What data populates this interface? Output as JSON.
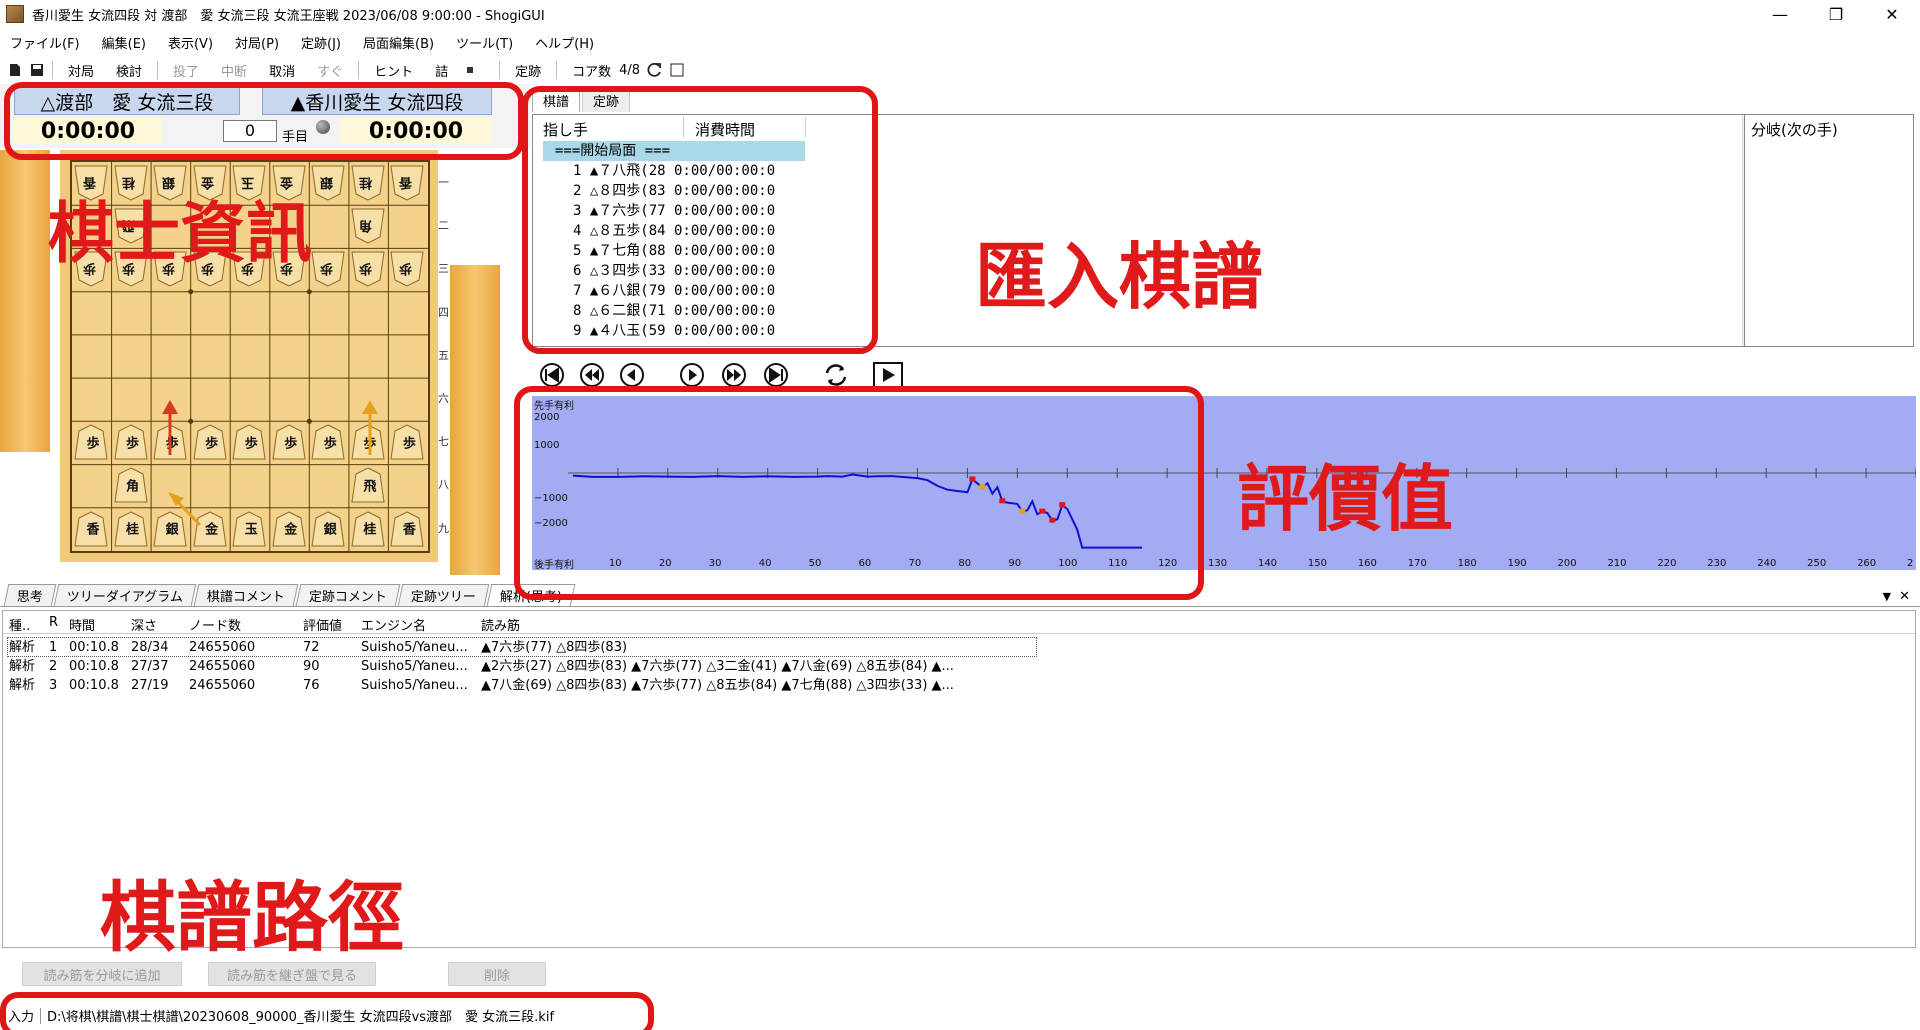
{
  "window": {
    "title": "香川愛生 女流四段 対 渡部　愛 女流三段 女流王座戦 2023/06/08 9:00:00 - ShogiGUI"
  },
  "menu": [
    "ファイル(F)",
    "編集(E)",
    "表示(V)",
    "対局(P)",
    "定跡(J)",
    "局面編集(B)",
    "ツール(T)",
    "ヘルプ(H)"
  ],
  "toolbar": {
    "taikyoku": "対局",
    "kento": "検討",
    "toryo": "投了",
    "chudan": "中断",
    "torikeshi": "取消",
    "sugu": "すぐ",
    "hint": "ヒント",
    "tsume": "詰",
    "joseki": "定跡",
    "cores_label": "コア数",
    "cores_value": "4/8"
  },
  "players": {
    "gote_name": "△渡部　愛 女流三段",
    "sente_name": "▲香川愛生 女流四段",
    "gote_time": "0:00:00",
    "sente_time": "0:00:00",
    "move_number": "0",
    "move_label": "手目"
  },
  "board": {
    "rank_labels": [
      "一",
      "二",
      "三",
      "四",
      "五",
      "六",
      "七",
      "八",
      "九"
    ]
  },
  "kifu": {
    "tabs": [
      "棋譜",
      "定跡"
    ],
    "col_move": "指し手",
    "col_time": "消費時間",
    "rows": [
      "===開始局面 ===",
      "1 ▲７八飛(28  0:00/00:00:0",
      "2 △８四歩(83  0:00/00:00:0",
      "3 ▲７六歩(77  0:00/00:00:0",
      "4 △８五歩(84  0:00/00:00:0",
      "5 ▲７七角(88  0:00/00:00:0",
      "6 △３四歩(33  0:00/00:00:0",
      "7 ▲６八銀(79  0:00/00:00:0",
      "8 △６二銀(71  0:00/00:00:0",
      "9 ▲４八玉(59  0:00/00:00:0"
    ],
    "branch_label": "分岐(次の手)"
  },
  "graph": {
    "top_label": "先手有利",
    "bottom_label": "後手有利",
    "y_ticks": [
      "2000",
      "1000",
      "−1000",
      "−2000"
    ],
    "x_ticks": [
      "10",
      "20",
      "30",
      "40",
      "50",
      "60",
      "70",
      "80",
      "90",
      "100",
      "110",
      "120",
      "130",
      "140",
      "150",
      "160",
      "170",
      "180",
      "190",
      "200",
      "210",
      "220",
      "230",
      "240",
      "250",
      "260",
      "2"
    ]
  },
  "chart_data": {
    "type": "line",
    "x": [
      1,
      5,
      10,
      15,
      20,
      25,
      30,
      35,
      40,
      45,
      50,
      52,
      55,
      57,
      60,
      62,
      65,
      68,
      70,
      72,
      74,
      76,
      78,
      80,
      81,
      83,
      84,
      85,
      86,
      87,
      88,
      90,
      91,
      92,
      93,
      94,
      95,
      96,
      97,
      98,
      99,
      100,
      101,
      102,
      103,
      104,
      105,
      106,
      107,
      108,
      109,
      110,
      115
    ],
    "y": [
      -100,
      -150,
      -150,
      -130,
      -140,
      -150,
      -120,
      -150,
      -130,
      -150,
      -140,
      -120,
      -140,
      -60,
      -140,
      -130,
      -120,
      -170,
      -200,
      -280,
      -500,
      -650,
      -700,
      -750,
      -250,
      -550,
      -400,
      -800,
      -550,
      -1100,
      -1150,
      -1200,
      -1500,
      -1450,
      -1100,
      -1600,
      -1500,
      -1550,
      -1850,
      -1800,
      -1250,
      -1400,
      -1800,
      -2200,
      -2900,
      -2900,
      -2900,
      -2900,
      -2900,
      -2900,
      -2900,
      -2900,
      -2900
    ],
    "ylim": [
      -2900,
      2400
    ],
    "xlim": [
      0,
      270
    ],
    "series_color": "#1010d0"
  },
  "bottom_tabs": [
    "思考",
    "ツリーダイアグラム",
    "棋譜コメント",
    "定跡コメント",
    "定跡ツリー",
    "解析(思考)"
  ],
  "engine": {
    "headers": [
      "種..",
      "R",
      "時間",
      "深さ",
      "ノード数",
      "評価値",
      "エンジン名",
      "読み筋"
    ],
    "rows": [
      [
        "解析",
        "1",
        "00:10.8",
        "28/34",
        "24655060",
        "72",
        "Suisho5/Yaneu...",
        "▲7六歩(77) △8四歩(83)"
      ],
      [
        "解析",
        "2",
        "00:10.8",
        "27/37",
        "24655060",
        "90",
        "Suisho5/Yaneu...",
        "▲2六歩(27) △8四歩(83) ▲7六歩(77) △3二金(41) ▲7八金(69) △8五歩(84) ▲..."
      ],
      [
        "解析",
        "3",
        "00:10.8",
        "27/19",
        "24655060",
        "76",
        "Suisho5/Yaneu...",
        "▲7八金(69) △8四歩(83) ▲7六歩(77) △8五歩(84) ▲7七角(88) △3四歩(33) ▲..."
      ]
    ]
  },
  "buttons": {
    "add_branch": "読み筋を分岐に追加",
    "view_board": "読み筋を継ぎ盤で見る",
    "delete": "削除"
  },
  "status": {
    "label": "入力",
    "path": "D:\\将棋\\棋譜\\棋士棋譜\\20230608_90000_香川愛生 女流四段vs渡部　愛 女流三段.kif"
  },
  "annotations": {
    "player_info": "棋士資訊",
    "import_kifu": "匯入棋譜",
    "evaluation": "評價值",
    "kifu_path": "棋譜路徑"
  }
}
